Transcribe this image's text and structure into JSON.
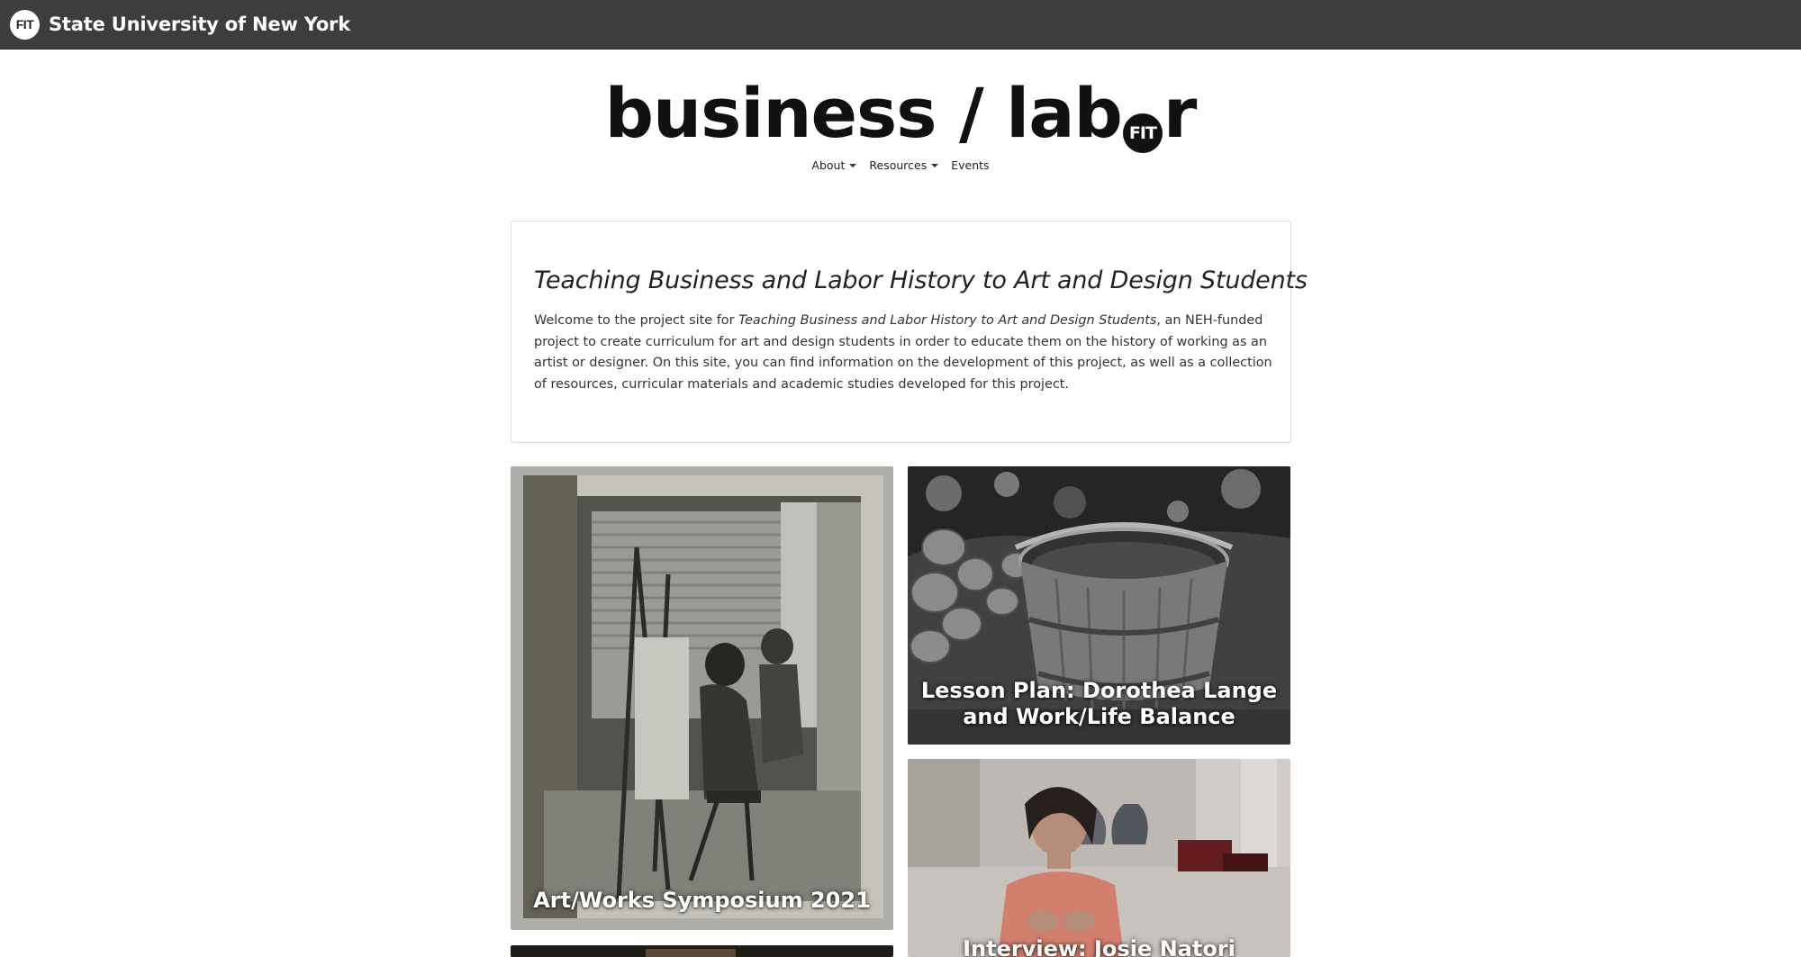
{
  "topbar": {
    "badge": "FIT",
    "title": "State University of New York"
  },
  "logo": {
    "text_before": "business / lab",
    "badge": "FIT",
    "text_after": "r"
  },
  "nav": {
    "items": [
      {
        "label": "About",
        "dropdown": true
      },
      {
        "label": "Resources",
        "dropdown": true
      },
      {
        "label": "Events",
        "dropdown": false
      }
    ]
  },
  "intro": {
    "title": "Teaching Business and Labor History to Art and Design Students",
    "body_prefix": "Welcome to the project site for ",
    "body_italic": "Teaching Business and Labor History to Art and Design Students",
    "body_suffix": ", an NEH-funded project to create curriculum for art and design students in order to educate them on the history of working as an artist or designer. On this site, you can find information on the development of this project, as well as a collection of resources, curricular materials and academic studies developed for this project."
  },
  "cards": [
    {
      "label": "Art/Works Symposium 2021",
      "image": "photo-women-painting-at-easels"
    },
    {
      "label": "Lesson Plan: Dorothea Lange and Work/Life Balance",
      "image": "photo-wooden-bucket-and-potatoes"
    },
    {
      "label": "Interview: Josie Natori",
      "image": "photo-woman-in-coral-top-interview"
    },
    {
      "label": "",
      "image": "photo-partial-card"
    }
  ]
}
